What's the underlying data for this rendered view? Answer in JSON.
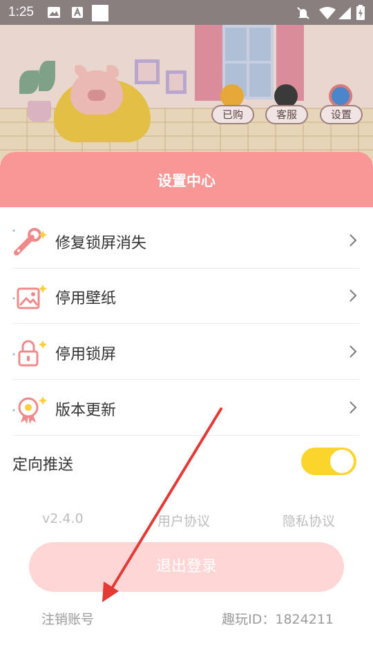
{
  "status_bar": {
    "time": "1:25"
  },
  "shortcuts": [
    {
      "label": "已购",
      "icon": "bag-icon"
    },
    {
      "label": "客服",
      "icon": "penguin-icon"
    },
    {
      "label": "设置",
      "icon": "gear-icon"
    }
  ],
  "panel": {
    "title": "设置中心",
    "items": [
      {
        "label": "修复锁屏消失",
        "icon": "wrench-icon"
      },
      {
        "label": "停用壁纸",
        "icon": "image-icon"
      },
      {
        "label": "停用锁屏",
        "icon": "lock-icon"
      },
      {
        "label": "版本更新",
        "icon": "badge-icon"
      }
    ],
    "push": {
      "label": "定向推送",
      "enabled": true
    },
    "links": {
      "version": "v2.4.0",
      "user_agreement": "用户协议",
      "privacy": "隐私协议"
    },
    "logout_label": "退出登录",
    "cancel_account": "注销账号",
    "user_id": "趣玩ID：1824211"
  },
  "colors": {
    "header": "#f99797",
    "toggle_on": "#fbd52c",
    "logout_bg": "#ffd6d6",
    "annotation_arrow": "#e53935"
  }
}
